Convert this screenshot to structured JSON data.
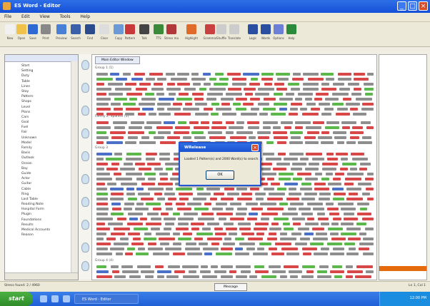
{
  "window": {
    "title": "ES Word - Editor"
  },
  "menu": [
    "File",
    "Edit",
    "View",
    "Tools",
    "Help"
  ],
  "toolbar": {
    "buttons": [
      {
        "label": "New",
        "color": "#f1f1f1"
      },
      {
        "label": "Open",
        "color": "#f0c24a"
      },
      {
        "label": "Save",
        "color": "#2f6ad4"
      },
      {
        "label": "Print",
        "color": "#888888"
      },
      {
        "label": "Preview",
        "color": "#4a7fd6"
      },
      {
        "label": "Search",
        "color": "#3b5fa8"
      },
      {
        "label": "Find",
        "color": "#2a4b8c"
      },
      {
        "label": "Clear",
        "color": "#dddddd"
      },
      {
        "label": "Copy",
        "color": "#6b9ad6"
      },
      {
        "label": "Pattern",
        "color": "#c83a3a"
      },
      {
        "label": "Talk",
        "color": "#444444"
      },
      {
        "label": "TTS",
        "color": "#3a8a3a"
      },
      {
        "label": "Stress mark",
        "color": "#b03838"
      },
      {
        "label": "Highlight",
        "color": "#e06a2a"
      },
      {
        "label": "Grammar",
        "color": "#c84040"
      },
      {
        "label": "Shuffle",
        "color": "#cccccc"
      },
      {
        "label": "Translate",
        "color": "#cccccc"
      },
      {
        "label": "Logic",
        "color": "#2a4fa0"
      },
      {
        "label": "Words",
        "color": "#2a4fa0"
      },
      {
        "label": "Options",
        "color": "#6b7fd6"
      },
      {
        "label": "Help",
        "color": "#2a8a3a"
      }
    ]
  },
  "left_panel": {
    "items": [
      "Start",
      "Setting",
      "Duty",
      "Table",
      "Lines",
      "Stay",
      "Pattern",
      "Shops",
      "Level",
      "Plans",
      "Cars",
      "Goal",
      "Fuel",
      "Fair",
      "Unknown",
      "Model",
      "Family",
      "Basis",
      "Outlook",
      "Ocean",
      "Bay",
      "Guide",
      "Actor",
      "Guitar",
      "Cable",
      "Ring",
      "Last Table",
      "Reading Note",
      "Hospital Form",
      "Plugin",
      "Foundations",
      "Results",
      "Medical Accounts",
      "Reason"
    ]
  },
  "main": {
    "tab_label": "Main Editor Window",
    "section_headers": [
      "Group 1 (1)",
      "Family 2, Spanish (1)",
      "Group 3",
      "Group 4 (4)"
    ]
  },
  "statusbar": {
    "left": "Stress found: 2 / 4960",
    "center": "Message",
    "right": "Ln 1, Col 1"
  },
  "modal": {
    "title": "WRelease",
    "message": "Loaded 1 Pattern(s) and 2000 Word(s) to search.",
    "ok_label": "OK"
  },
  "taskbar": {
    "start_label": "start",
    "task_label": "ES Word - Editor",
    "clock": "12:00 PM"
  },
  "colors": {
    "highlight_red": "#d84848",
    "highlight_green": "#5cb84a",
    "highlight_blue": "#4a70c8",
    "accent_orange": "#e46a0c"
  }
}
